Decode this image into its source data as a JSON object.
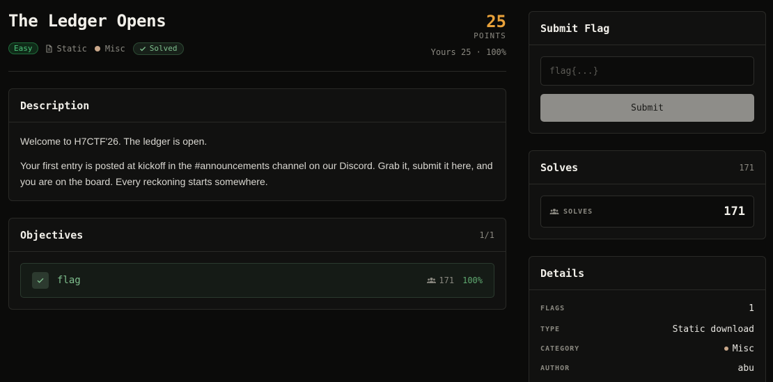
{
  "challenge": {
    "title": "The Ledger Opens",
    "difficulty": "Easy",
    "type": "Static",
    "category": "Misc",
    "status": "Solved",
    "points": "25",
    "points_label": "POINTS",
    "points_sub": "Yours 25 · 100%"
  },
  "description": {
    "heading": "Description",
    "paragraphs": [
      "Welcome to H7CTF'26. The ledger is open.",
      "Your first entry is posted at kickoff in the #announcements channel on our Discord. Grab it, submit it here, and you are on the board. Every reckoning starts somewhere."
    ]
  },
  "objectives": {
    "heading": "Objectives",
    "count": "1/1",
    "items": [
      {
        "name": "flag",
        "solves": "171",
        "percent": "100%"
      }
    ]
  },
  "submit": {
    "heading": "Submit Flag",
    "placeholder": "flag{...}",
    "button": "Submit"
  },
  "solves": {
    "heading": "Solves",
    "count": "171",
    "label": "SOLVES",
    "value": "171"
  },
  "details": {
    "heading": "Details",
    "rows": [
      {
        "key": "FLAGS",
        "value": "1"
      },
      {
        "key": "TYPE",
        "value": "Static download"
      },
      {
        "key": "CATEGORY",
        "value": "Misc"
      },
      {
        "key": "AUTHOR",
        "value": "abu"
      }
    ]
  },
  "colors": {
    "accent_points": "#e8a13a",
    "easy_green": "#4cc47a",
    "solved_green": "#7fbf8e",
    "category_dot": "#c9a78a"
  },
  "icons": {
    "type": "file-icon",
    "solved": "check-icon",
    "solvers": "users-icon"
  }
}
